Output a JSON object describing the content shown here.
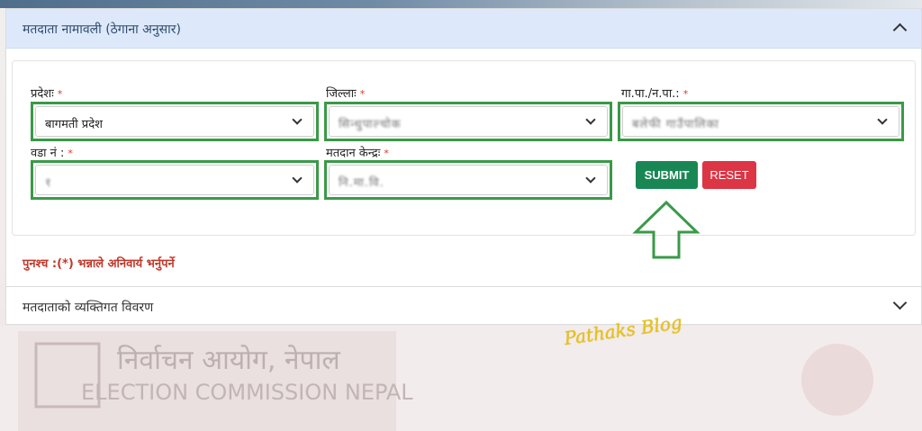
{
  "section1": {
    "title": "मतदाता नामावली (ठेगाना अनुसार)"
  },
  "form": {
    "required_mark": "*",
    "province": {
      "label": "प्रदेशः",
      "value": "बागमती प्रदेश"
    },
    "district": {
      "label": "जिल्लाः",
      "value": "सिन्धुपाल्चोक"
    },
    "municipality": {
      "label": "गा.पा./न.पा.:",
      "value": "बलेफी गाउँपालिका"
    },
    "ward": {
      "label": "वडा नं :",
      "value": "१"
    },
    "polling_center": {
      "label": "मतदान केन्द्रः",
      "value": "नि.मा.वि."
    },
    "submit_label": "SUBMIT",
    "reset_label": "RESET"
  },
  "note": "पुनश्च :(*) भन्नाले अनिवार्य भर्नुपर्ने",
  "section2": {
    "title": "मतदाताको व्यक्तिगत विवरण"
  },
  "watermark": "Pathaks Blog",
  "background_banner": {
    "line1": "निर्वाचन आयोग, नेपाल",
    "line2": "ELECTION COMMISSION NEPAL"
  },
  "colors": {
    "highlight_border": "#3a9a47",
    "submit": "#198754",
    "reset": "#dc3545",
    "header_bg": "#dde9fb"
  }
}
